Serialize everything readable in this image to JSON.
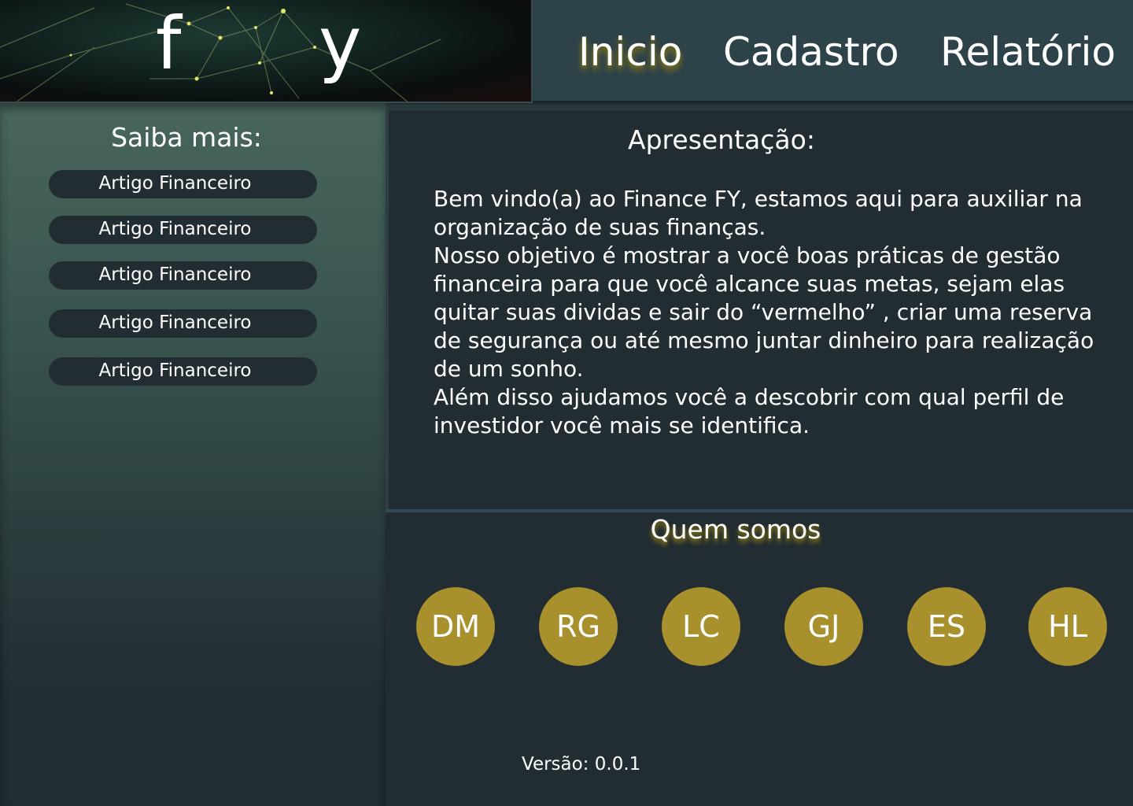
{
  "header": {
    "logo": {
      "letter_left": "f",
      "letter_right": "y"
    },
    "nav": [
      {
        "label": "Inicio",
        "active": true
      },
      {
        "label": "Cadastro",
        "active": false
      },
      {
        "label": "Relatório",
        "active": false
      }
    ]
  },
  "sidebar": {
    "title": "Saiba mais:",
    "articles": [
      {
        "label": "Artigo Financeiro"
      },
      {
        "label": "Artigo Financeiro"
      },
      {
        "label": "Artigo Financeiro"
      },
      {
        "label": "Artigo Financeiro"
      },
      {
        "label": "Artigo Financeiro"
      }
    ]
  },
  "main": {
    "apresentacao": {
      "title": "Apresentação:",
      "text": " Bem vindo(a) ao Finance FY, estamos aqui para auxiliar na organização de suas finanças.\n Nosso objetivo é mostrar a você boas práticas de gestão financeira para que você alcance suas metas, sejam elas quitar suas dividas e sair do “vermelho” , criar uma reserva de segurança ou até mesmo juntar dinheiro para realização de um sonho.\n Além disso ajudamos você a descobrir com qual perfil de investidor você mais se identifica."
    },
    "quem_somos": {
      "title": "Quem somos",
      "members": [
        {
          "initials": "DM"
        },
        {
          "initials": "RG"
        },
        {
          "initials": "LC"
        },
        {
          "initials": "GJ"
        },
        {
          "initials": "ES"
        },
        {
          "initials": "HL"
        }
      ]
    }
  },
  "footer": {
    "version": "Versão: 0.0.1"
  },
  "colors": {
    "background": "#212d32",
    "header_nav": "#2d4249",
    "sidebar_top": "#48665d",
    "accent_gold": "#a8902d"
  }
}
